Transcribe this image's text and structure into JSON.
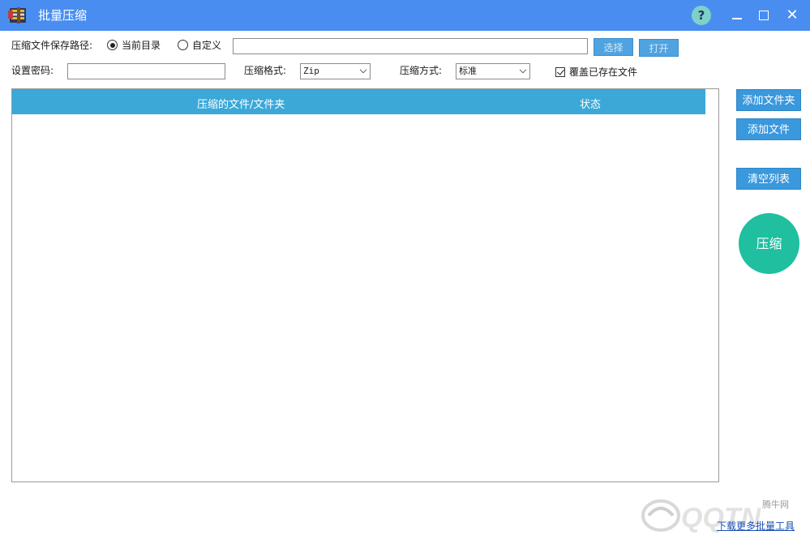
{
  "window": {
    "title": "批量压缩",
    "help_label": "?"
  },
  "save_path": {
    "label": "压缩文件保存路径:",
    "option_current": "当前目录",
    "option_custom": "自定义",
    "selected": "当前目录",
    "path_value": "",
    "choose_label": "选择",
    "open_label": "打开"
  },
  "password": {
    "label": "设置密码:",
    "value": ""
  },
  "format": {
    "label": "压缩格式:",
    "value": "Zip"
  },
  "method": {
    "label": "压缩方式:",
    "value": "标准"
  },
  "overwrite": {
    "label": "覆盖已存在文件",
    "checked": true
  },
  "list": {
    "columns": [
      "压缩的文件/文件夹",
      "状态"
    ],
    "rows": []
  },
  "side": {
    "add_folder": "添加文件夹",
    "add_file": "添加文件",
    "clear_list": "清空列表",
    "compress": "压缩"
  },
  "footer": {
    "link": "下载更多批量工具"
  },
  "watermark": {
    "site": "腾牛网",
    "brand": "QQTN"
  },
  "colors": {
    "titlebar": "#4a8df0",
    "list_header": "#3ba8d8",
    "button": "#3a98dc",
    "compress": "#1fbfa0"
  }
}
